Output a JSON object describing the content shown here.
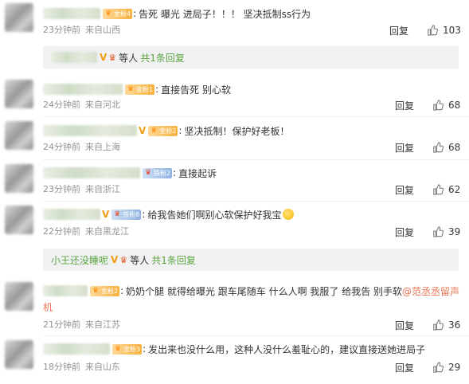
{
  "comments": [
    {
      "badge": "金粉4",
      "badge_type": "gold",
      "text": "告死 曝光 进局子！！！ 坚决抵制ss行为",
      "time": "23分钟前",
      "location": "来自山西",
      "reply": "回复",
      "likes": "103"
    },
    {
      "badge": "金粉1",
      "badge_type": "gold",
      "text": "直接告死 别心软",
      "time": "24分钟前",
      "location": "来自河北",
      "reply": "回复",
      "likes": "68"
    },
    {
      "badge": "金粉2",
      "badge_type": "gold",
      "text": "坚决抵制！保护好老板！",
      "time": "24分钟前",
      "location": "来自上海",
      "reply": "回复",
      "likes": "68"
    },
    {
      "badge": "铁粉2",
      "badge_type": "iron",
      "text": "直接起诉",
      "time": "23分钟前",
      "location": "来自浙江",
      "reply": "回复",
      "likes": "62"
    },
    {
      "badge": "铁粉8",
      "badge_type": "iron",
      "text": "给我告她们啊别心软保护好我宝",
      "time": "22分钟前",
      "location": "来自黑龙江",
      "reply": "回复",
      "likes": "39"
    },
    {
      "badge": "金粉2",
      "badge_type": "gold",
      "text_before": "奶奶个腿 就得给曝光 跟车尾随车 什么人啊 我服了 给我告 别手软",
      "mention": "@范丞丞留声",
      "text_after": "机",
      "time": "21分钟前",
      "location": "来自江苏",
      "reply": "回复",
      "likes": "36"
    },
    {
      "badge": "金粉3",
      "badge_type": "gold",
      "text": "发出来也没什么用，这种人没什么羞耻心的，建议直接送她进局子",
      "time": "18分钟前",
      "location": "来自山东",
      "reply": "回复",
      "likes": "29"
    }
  ],
  "sub_replies": [
    {
      "name": "",
      "deng": "等人",
      "more": "共1条回复"
    },
    {
      "name": "小王还没睡呢",
      "deng": "等人",
      "more": "共1条回复"
    }
  ],
  "icons": {
    "like": "thumbs-up-icon",
    "crown": "crown-icon",
    "verified": "v-badge-icon"
  },
  "colors": {
    "link_green": "#5aa63f",
    "mention": "#eb7350",
    "meta_gray": "#939393",
    "sub_bg": "#f2f2f5"
  }
}
